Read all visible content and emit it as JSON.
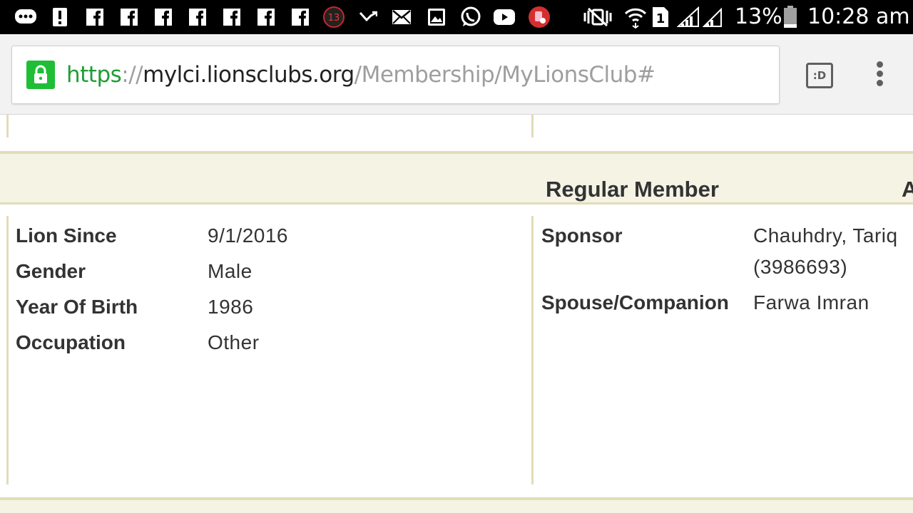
{
  "status_bar": {
    "notifications": [
      "messenger-icon",
      "alert-icon",
      "facebook-icon",
      "facebook-icon",
      "facebook-icon",
      "facebook-icon",
      "facebook-icon",
      "facebook-icon",
      "facebook-icon",
      "badge-13-icon",
      "missed-call-icon",
      "email-icon",
      "gallery-icon",
      "whatsapp-icon",
      "youtube-icon",
      "app-red-icon"
    ],
    "badge_count": "13",
    "sim_label": "1",
    "battery": "13%",
    "time": "10:28 am"
  },
  "browser": {
    "url_scheme": "https",
    "url_separator": "://",
    "url_host": "mylci.lionsclubs.org",
    "url_path": "/Membership/MyLionsClub#",
    "tabs_button_label": ":D",
    "secure_color": "#1fbe36"
  },
  "member": {
    "band_title": "Regular Member",
    "band_title_next": "A",
    "left_fields": [
      {
        "label": "Lion Since",
        "value": "9/1/2016"
      },
      {
        "label": "Gender",
        "value": "Male"
      },
      {
        "label": "Year Of Birth",
        "value": "1986"
      },
      {
        "label": "Occupation",
        "value": "Other"
      }
    ],
    "sponsor_label": "Sponsor",
    "sponsor_name": "Chauhdry, Tariq",
    "sponsor_id": "(3986693)",
    "spouse_label": "Spouse/Companion",
    "spouse_value": "Farwa Imran"
  },
  "colors": {
    "divider": "#e2dcb9",
    "band": "#f5f3e4",
    "text": "#333333"
  }
}
